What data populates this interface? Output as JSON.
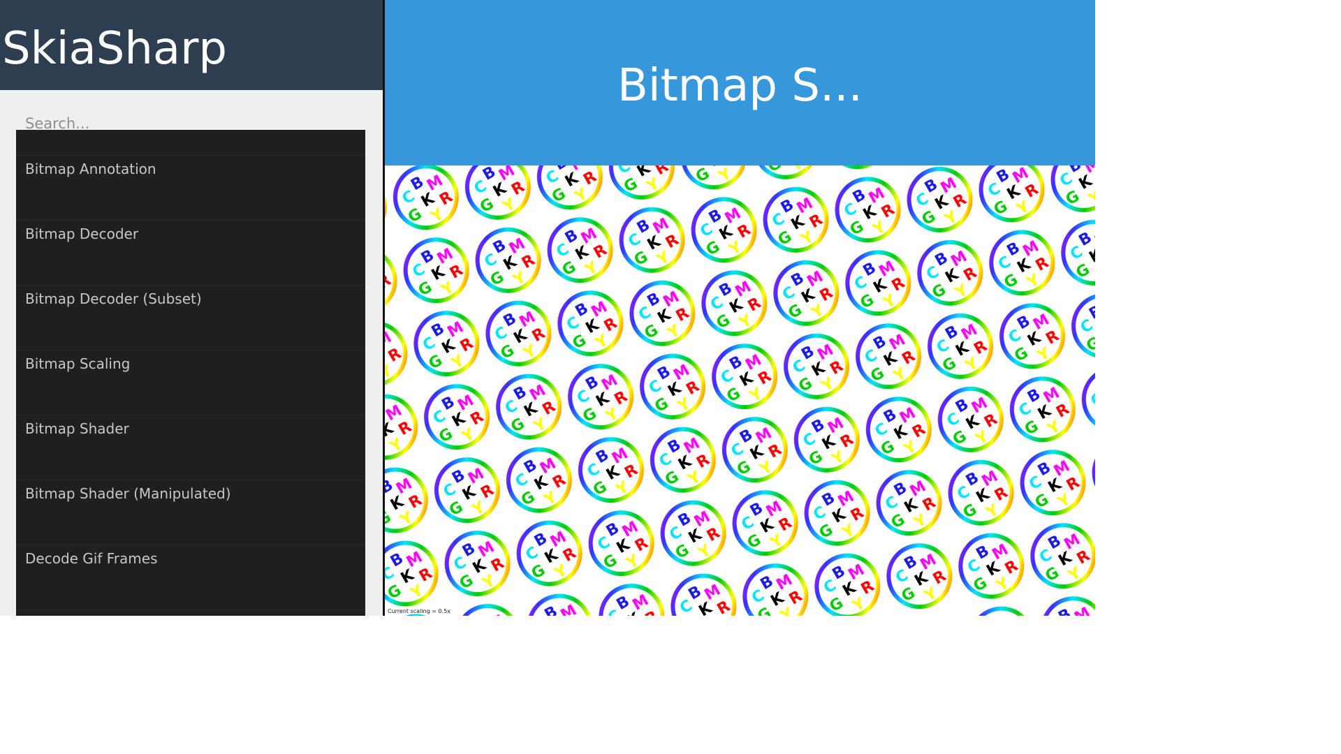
{
  "app": {
    "title": "SkiaSharp"
  },
  "search": {
    "placeholder": "Search..."
  },
  "sidebar": {
    "items": [
      {
        "label": "Bitmap Annotation"
      },
      {
        "label": "Bitmap Decoder"
      },
      {
        "label": "Bitmap Decoder (Subset)"
      },
      {
        "label": "Bitmap Scaling"
      },
      {
        "label": "Bitmap Shader"
      },
      {
        "label": "Bitmap Shader (Manipulated)"
      },
      {
        "label": "Decode Gif Frames"
      }
    ]
  },
  "detail": {
    "title": "Bitmap S...",
    "status_text": "Current scaling = 0.5x"
  },
  "tile": {
    "letters": [
      "C",
      "B",
      "M",
      "G",
      "K",
      "R",
      "Y"
    ],
    "colors": {
      "C": "#00e5ff",
      "B": "#1a1ae6",
      "M": "#ff00ff",
      "G": "#00cc00",
      "K": "#000000",
      "R": "#ff0000",
      "Y": "#ffff00"
    }
  },
  "colors": {
    "app_header": "#2c3e50",
    "detail_header": "#3797db",
    "list_background": "#1f1f1f",
    "sidebar_background": "#efefef"
  }
}
